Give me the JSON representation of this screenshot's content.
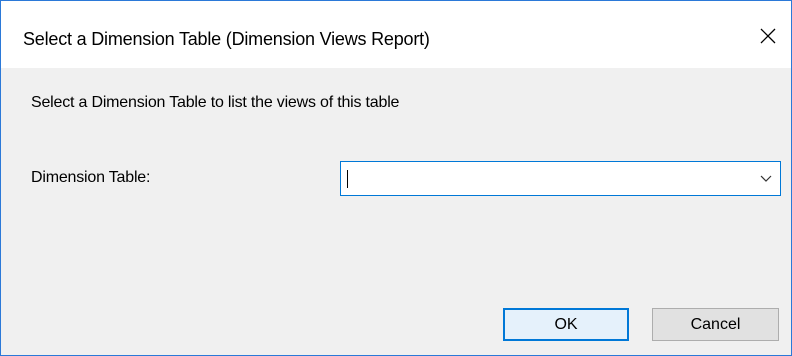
{
  "window": {
    "title": "Select a Dimension Table (Dimension Views Report)",
    "close_icon": "close-icon"
  },
  "content": {
    "instruction": "Select a Dimension Table to list the views of this table",
    "dimension_label": "Dimension Table:",
    "dimension_value": "",
    "dropdown_icon": "chevron-down-icon"
  },
  "buttons": {
    "ok_label": "OK",
    "cancel_label": "Cancel"
  },
  "colors": {
    "accent": "#0078d7",
    "window_border": "#2b79d8",
    "dialog_background": "#f0f0f0"
  }
}
